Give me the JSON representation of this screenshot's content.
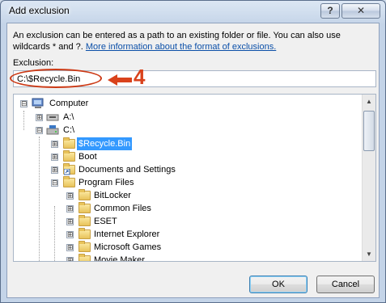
{
  "window": {
    "title": "Add exclusion",
    "help_label": "?",
    "close_label": "✕"
  },
  "description": {
    "text": "An exclusion can be entered as a path to an existing folder or file. You can also use wildcards * and ?.",
    "link": "More information about the format of exclusions."
  },
  "exclusion": {
    "label": "Exclusion:",
    "value": "C:\\$Recycle.Bin"
  },
  "annotation": {
    "number": "4",
    "arrow": "◀━",
    "color": "#d9421c"
  },
  "tree": {
    "items": [
      {
        "label": "Computer",
        "icon": "computer-icon",
        "expander": "⊟"
      },
      {
        "label": "A:\\",
        "icon": "floppy-drive-icon",
        "expander": "⊞"
      },
      {
        "label": "C:\\",
        "icon": "hard-drive-icon",
        "expander": "⊟"
      },
      {
        "label": "$Recycle.Bin",
        "icon": "folder-icon",
        "expander": "⊞",
        "selected": true
      },
      {
        "label": "Boot",
        "icon": "folder-icon",
        "expander": "⊞"
      },
      {
        "label": "Documents and Settings",
        "icon": "folder-shortcut-icon",
        "expander": "⊞"
      },
      {
        "label": "Program Files",
        "icon": "folder-icon",
        "expander": "⊟"
      },
      {
        "label": "BitLocker",
        "icon": "folder-icon",
        "expander": "⊞"
      },
      {
        "label": "Common Files",
        "icon": "folder-icon",
        "expander": "⊞"
      },
      {
        "label": "ESET",
        "icon": "folder-icon",
        "expander": "⊞"
      },
      {
        "label": "Internet Explorer",
        "icon": "folder-icon",
        "expander": "⊞"
      },
      {
        "label": "Microsoft Games",
        "icon": "folder-icon",
        "expander": "⊞"
      },
      {
        "label": "Movie Maker",
        "icon": "folder-icon",
        "expander": "⊞"
      }
    ]
  },
  "buttons": {
    "ok": "OK",
    "cancel": "Cancel"
  }
}
